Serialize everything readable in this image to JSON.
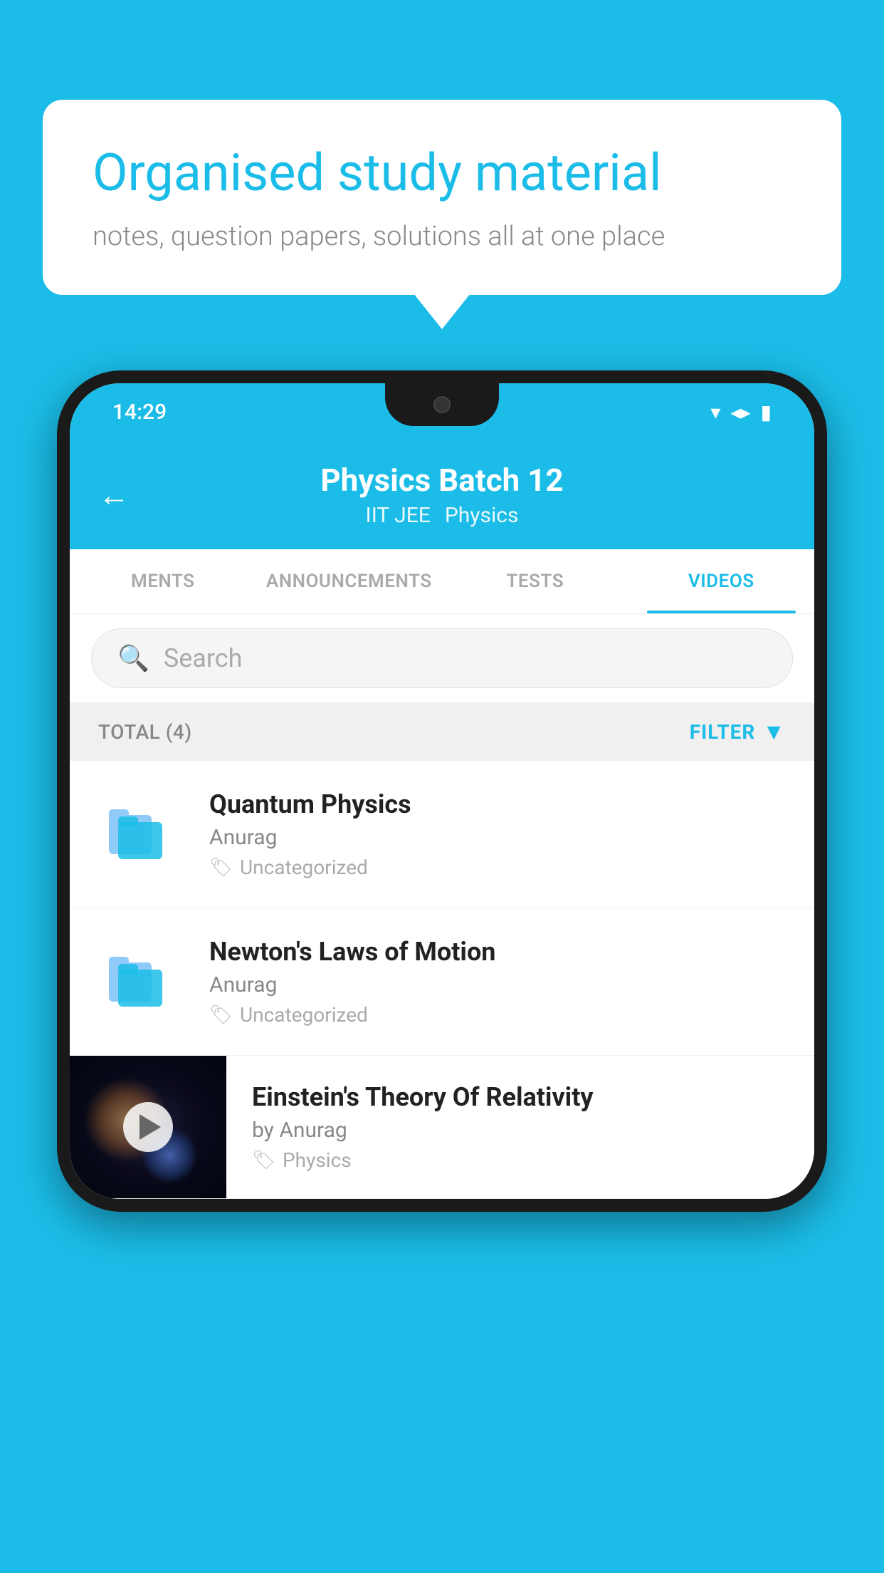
{
  "background": {
    "color": "#1BBDE8"
  },
  "speech_bubble": {
    "heading": "Organised study material",
    "subtitle": "notes, question papers, solutions all at one place"
  },
  "phone": {
    "status_bar": {
      "time": "14:29"
    },
    "header": {
      "back_label": "←",
      "title": "Physics Batch 12",
      "tags": [
        "IIT JEE",
        "Physics"
      ]
    },
    "tabs": [
      {
        "label": "MENTS",
        "active": false
      },
      {
        "label": "ANNOUNCEMENTS",
        "active": false
      },
      {
        "label": "TESTS",
        "active": false
      },
      {
        "label": "VIDEOS",
        "active": true
      }
    ],
    "search": {
      "placeholder": "Search"
    },
    "filter_bar": {
      "total_label": "TOTAL (4)",
      "filter_label": "FILTER"
    },
    "videos": [
      {
        "id": 1,
        "title": "Quantum Physics",
        "author": "Anurag",
        "tag": "Uncategorized",
        "type": "folder"
      },
      {
        "id": 2,
        "title": "Newton's Laws of Motion",
        "author": "Anurag",
        "tag": "Uncategorized",
        "type": "folder"
      },
      {
        "id": 3,
        "title": "Einstein's Theory Of Relativity",
        "author": "by Anurag",
        "tag": "Physics",
        "type": "video"
      }
    ]
  }
}
